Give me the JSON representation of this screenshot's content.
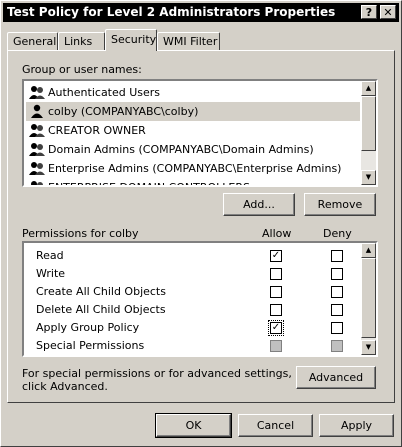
{
  "window": {
    "title": "Test Policy for Level 2 Administrators Properties",
    "help_glyph": "?",
    "close_glyph": "✕"
  },
  "tabs": [
    {
      "label": "General"
    },
    {
      "label": "Links"
    },
    {
      "label": "Security",
      "active": true
    },
    {
      "label": "WMI Filter"
    }
  ],
  "group_list": {
    "label": "Group or user names:",
    "items": [
      {
        "name": "Authenticated Users"
      },
      {
        "name": "colby (COMPANYABC\\colby)",
        "selected": true
      },
      {
        "name": "CREATOR OWNER"
      },
      {
        "name": "Domain Admins (COMPANYABC\\Domain Admins)"
      },
      {
        "name": "Enterprise Admins (COMPANYABC\\Enterprise Admins)"
      },
      {
        "name": "ENTERPRISE DOMAIN CONTROLLERS"
      }
    ]
  },
  "buttons": {
    "add": "Add...",
    "remove": "Remove",
    "advanced": "Advanced",
    "ok": "OK",
    "cancel": "Cancel",
    "apply": "Apply"
  },
  "permissions": {
    "label": "Permissions for colby",
    "allow_header": "Allow",
    "deny_header": "Deny",
    "rows": [
      {
        "name": "Read",
        "allow": "checked",
        "deny": "unchecked"
      },
      {
        "name": "Write",
        "allow": "unchecked",
        "deny": "unchecked"
      },
      {
        "name": "Create All Child Objects",
        "allow": "unchecked",
        "deny": "unchecked"
      },
      {
        "name": "Delete All Child Objects",
        "allow": "unchecked",
        "deny": "unchecked"
      },
      {
        "name": "Apply Group Policy",
        "allow": "checked",
        "deny": "unchecked"
      },
      {
        "name": "Special Permissions",
        "allow": "disabled",
        "deny": "disabled"
      }
    ]
  },
  "advanced_note": {
    "line1": "For special permissions or for advanced settings,",
    "line2": "click Advanced."
  },
  "check_glyph": "✓"
}
